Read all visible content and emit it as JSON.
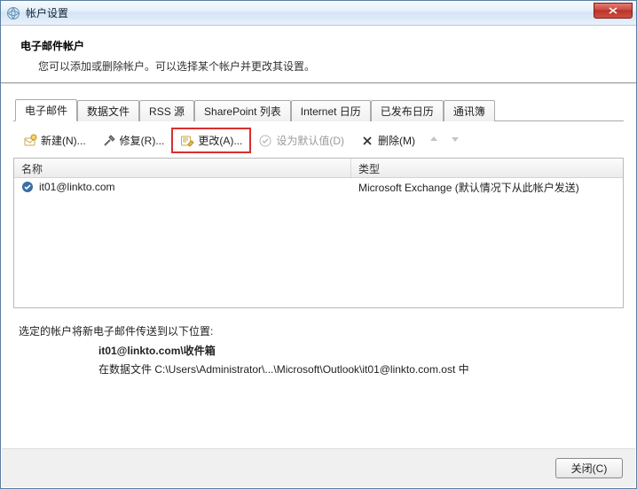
{
  "window": {
    "title": "帐户设置"
  },
  "header": {
    "title": "电子邮件帐户",
    "desc": "您可以添加或删除帐户。可以选择某个帐户并更改其设置。"
  },
  "tabs": [
    {
      "label": "电子邮件",
      "active": true
    },
    {
      "label": "数据文件",
      "active": false
    },
    {
      "label": "RSS 源",
      "active": false
    },
    {
      "label": "SharePoint 列表",
      "active": false
    },
    {
      "label": "Internet 日历",
      "active": false
    },
    {
      "label": "已发布日历",
      "active": false
    },
    {
      "label": "通讯簿",
      "active": false
    }
  ],
  "toolbar": {
    "new": "新建(N)...",
    "repair": "修复(R)...",
    "change": "更改(A)...",
    "set_default": "设为默认值(D)",
    "remove": "删除(M)"
  },
  "list": {
    "columns": {
      "name": "名称",
      "type": "类型"
    },
    "rows": [
      {
        "name": "it01@linkto.com",
        "type": "Microsoft Exchange (默认情况下从此帐户发送)"
      }
    ]
  },
  "delivery": {
    "intro": "选定的帐户将新电子邮件传送到以下位置:",
    "target": "it01@linkto.com\\收件箱",
    "path": "在数据文件 C:\\Users\\Administrator\\...\\Microsoft\\Outlook\\it01@linkto.com.ost 中"
  },
  "footer": {
    "close": "关闭(C)"
  }
}
